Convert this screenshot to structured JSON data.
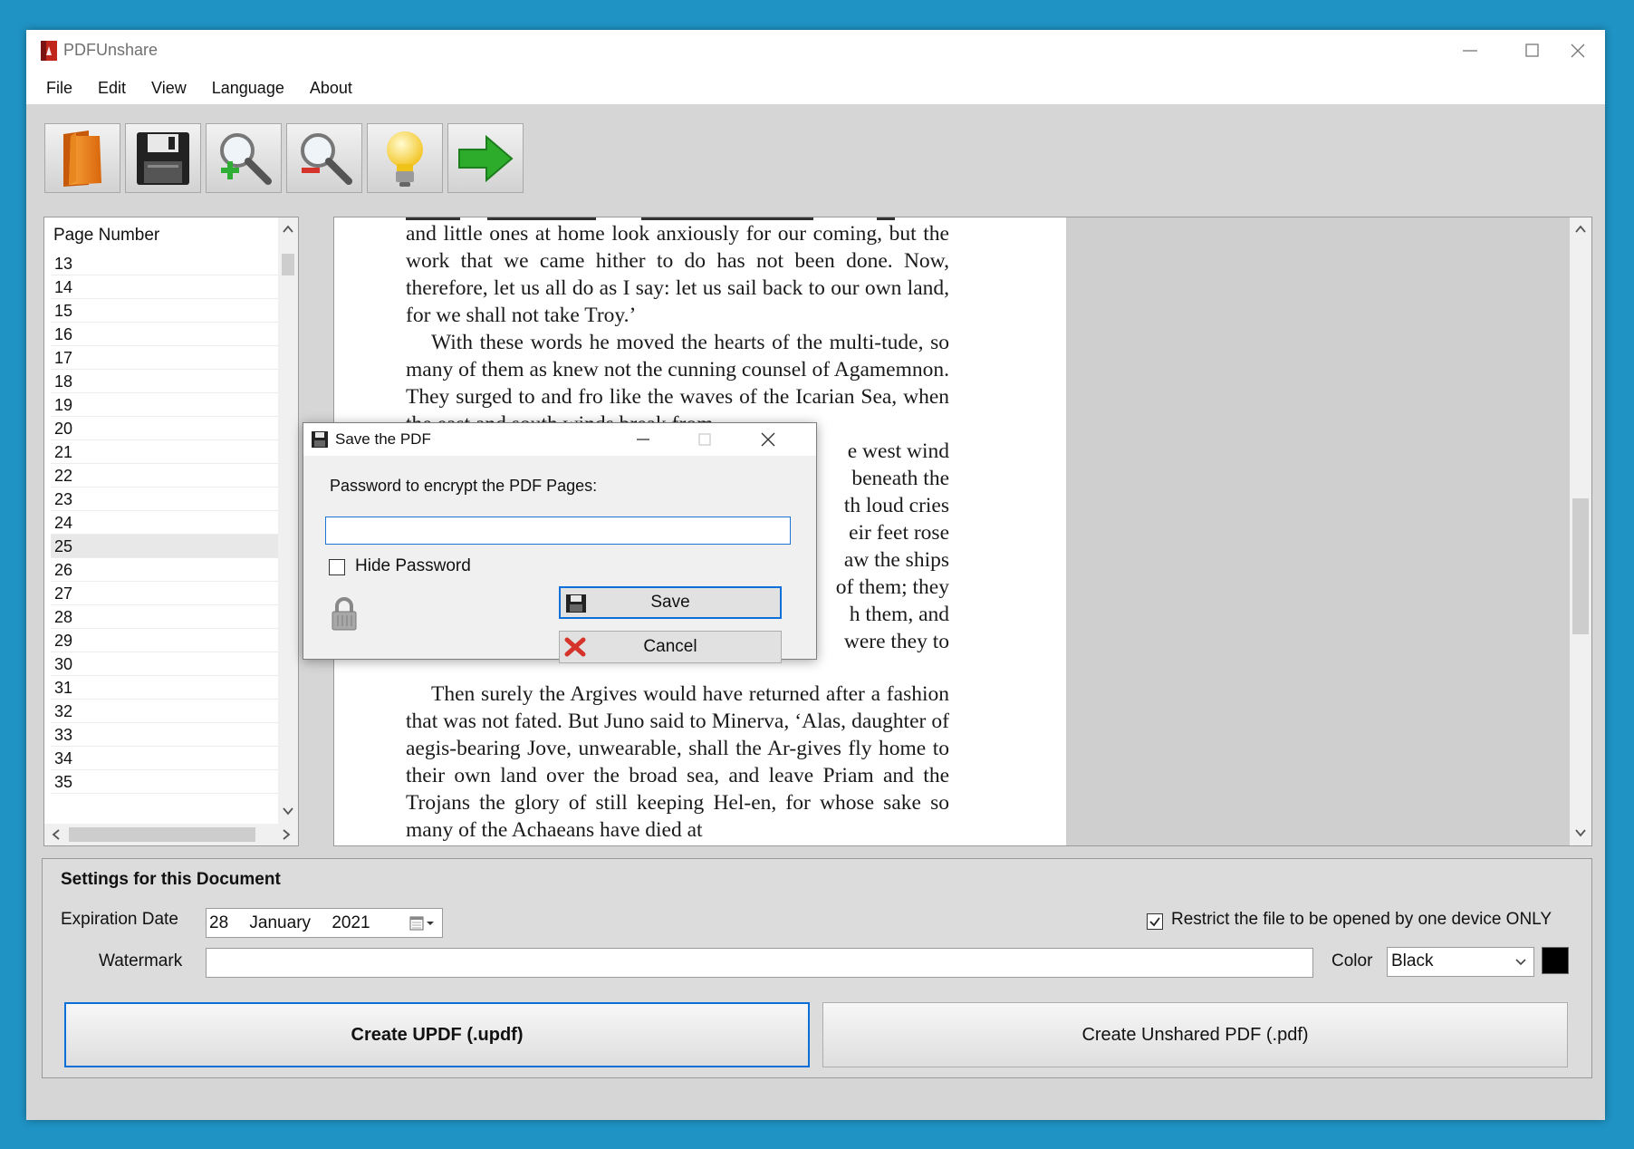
{
  "app": {
    "title": "PDFUnshare"
  },
  "menu": [
    "File",
    "Edit",
    "View",
    "Language",
    "About"
  ],
  "toolbar": [
    {
      "icon": "open-folder-icon"
    },
    {
      "icon": "save-icon"
    },
    {
      "icon": "zoom-in-icon"
    },
    {
      "icon": "zoom-out-icon"
    },
    {
      "icon": "lightbulb-icon"
    },
    {
      "icon": "next-arrow-icon"
    }
  ],
  "page_list": {
    "header": "Page Number",
    "pages": [
      "13",
      "14",
      "15",
      "16",
      "17",
      "18",
      "19",
      "20",
      "21",
      "22",
      "23",
      "24",
      "25",
      "26",
      "27",
      "28",
      "29",
      "30",
      "31",
      "32",
      "33",
      "34",
      "35"
    ],
    "selected": "25"
  },
  "document": {
    "paragraphs": [
      "and little ones at home look anxiously for our coming, but the work that we came hither to do has not been done. Now, therefore, let us all do as I say: let us sail back to our own land, for we shall not take Troy.’",
      "With these words he moved the hearts of the multi-tude, so many of them as knew not the cunning counsel of Agamemnon. They surged to and fro like the waves of the Icarian Sea, when the east and south winds break from",
      "e west wind",
      "beneath the",
      "th loud cries",
      "eir feet rose",
      "aw the ships",
      "of them; they",
      "h them, and",
      "were they to",
      "Then surely the Argives would have returned after a fashion that was not fated. But Juno said to Minerva, ‘Alas, daughter of aegis-bearing Jove, unwearable, shall the Ar-gives fly home to their own land over the broad sea, and leave Priam and the Trojans the glory of still keeping Hel-en, for whose sake so many of the Achaeans have died at"
    ]
  },
  "dialog": {
    "title": "Save the PDF",
    "password_label": "Password to encrypt the PDF Pages:",
    "password_value": "",
    "hide_password_label": "Hide Password",
    "hide_password_checked": false,
    "save_label": "Save",
    "cancel_label": "Cancel"
  },
  "settings": {
    "title": "Settings for this Document",
    "expiration_label": "Expiration Date",
    "expiration_day": "28",
    "expiration_month": "January",
    "expiration_year": "2021",
    "watermark_label": "Watermark",
    "watermark_value": "",
    "color_label": "Color",
    "color_value": "Black",
    "swatch_color": "#000000",
    "restrict_label": "Restrict the file to be opened by one device ONLY",
    "restrict_checked": true,
    "create_updf_label": "Create UPDF (.updf)",
    "create_pdf_label": "Create Unshared PDF (.pdf)"
  }
}
